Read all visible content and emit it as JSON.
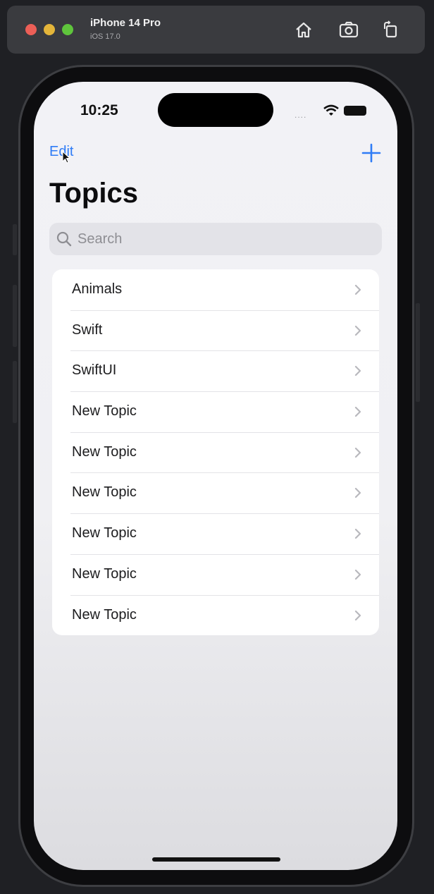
{
  "simulator": {
    "device_name": "iPhone 14 Pro",
    "os_version": "iOS 17.0",
    "toolbar_icons": [
      "home-icon",
      "screenshot-icon",
      "rotate-icon"
    ]
  },
  "status_bar": {
    "time": "10:25",
    "signal_dots": "....",
    "icons": [
      "wifi-icon",
      "battery-icon"
    ]
  },
  "nav": {
    "edit_label": "Edit",
    "add_icon": "plus-icon",
    "accent_color": "#2f7cf6"
  },
  "page": {
    "title": "Topics"
  },
  "search": {
    "placeholder": "Search"
  },
  "topics": [
    {
      "label": "Animals"
    },
    {
      "label": "Swift"
    },
    {
      "label": "SwiftUI"
    },
    {
      "label": "New Topic"
    },
    {
      "label": "New Topic"
    },
    {
      "label": "New Topic"
    },
    {
      "label": "New Topic"
    },
    {
      "label": "New Topic"
    },
    {
      "label": "New Topic"
    }
  ]
}
